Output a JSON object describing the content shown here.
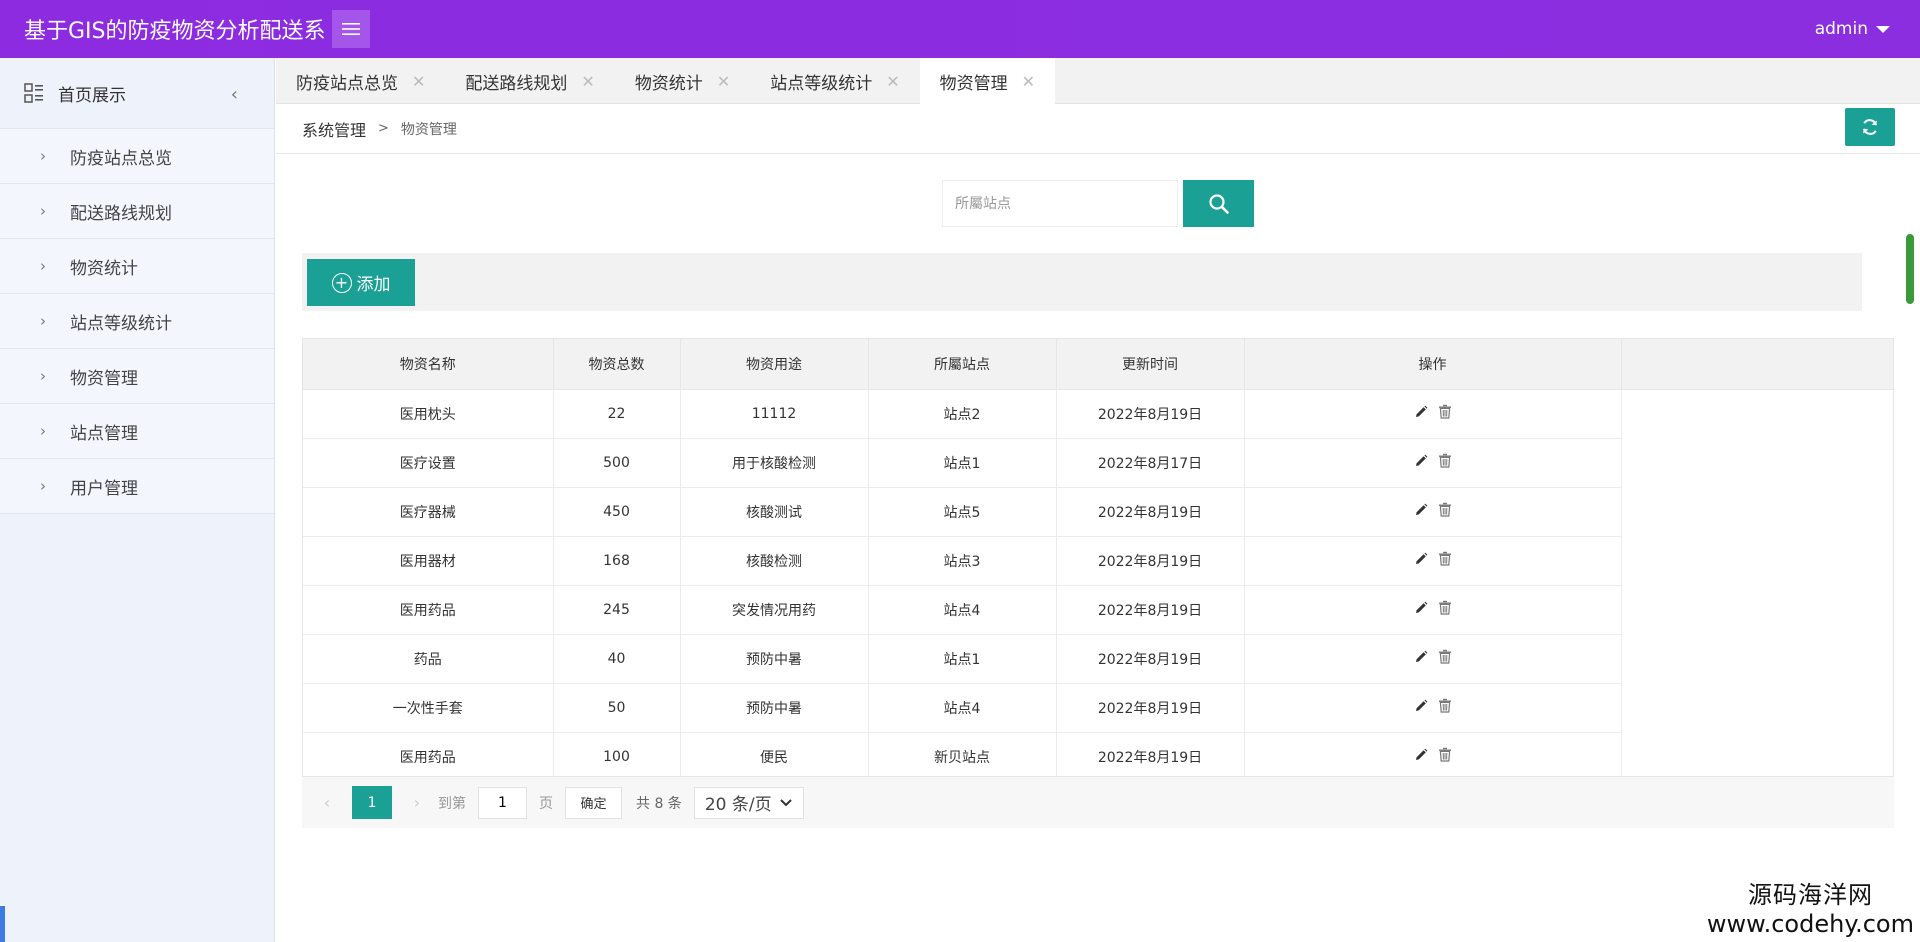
{
  "header": {
    "title": "基于GIS的防疫物资分析配送系",
    "user": "admin"
  },
  "sidebar": {
    "home_label": "首页展示",
    "items": [
      {
        "label": "防疫站点总览"
      },
      {
        "label": "配送路线规划"
      },
      {
        "label": "物资统计"
      },
      {
        "label": "站点等级统计"
      },
      {
        "label": "物资管理"
      },
      {
        "label": "站点管理"
      },
      {
        "label": "用户管理"
      }
    ]
  },
  "tabs": [
    {
      "label": "防疫站点总览",
      "active": false
    },
    {
      "label": "配送路线规划",
      "active": false
    },
    {
      "label": "物资统计",
      "active": false
    },
    {
      "label": "站点等级统计",
      "active": false
    },
    {
      "label": "物资管理",
      "active": true
    }
  ],
  "breadcrumb": {
    "root": "系统管理",
    "separator": ">",
    "current": "物资管理"
  },
  "search": {
    "placeholder": "所屬站点",
    "value": ""
  },
  "toolbar": {
    "add_label": "添加"
  },
  "table": {
    "columns": [
      "物资名称",
      "物资总数",
      "物资用途",
      "所屬站点",
      "更新时间",
      "操作"
    ],
    "rows": [
      [
        "医用枕头",
        "22",
        "11112",
        "站点2",
        "2022年8月19日"
      ],
      [
        "医疗设置",
        "500",
        "用于核酸检测",
        "站点1",
        "2022年8月17日"
      ],
      [
        "医疗器械",
        "450",
        "核酸测试",
        "站点5",
        "2022年8月19日"
      ],
      [
        "医用器材",
        "168",
        "核酸检测",
        "站点3",
        "2022年8月19日"
      ],
      [
        "医用药品",
        "245",
        "突发情况用药",
        "站点4",
        "2022年8月19日"
      ],
      [
        "药品",
        "40",
        "预防中暑",
        "站点1",
        "2022年8月19日"
      ],
      [
        "一次性手套",
        "50",
        "预防中暑",
        "站点4",
        "2022年8月19日"
      ],
      [
        "医用药品",
        "100",
        "便民",
        "新贝站点",
        "2022年8月19日"
      ]
    ]
  },
  "pager": {
    "current_page": "1",
    "goto_label": "到第",
    "goto_value": "1",
    "page_label": "页",
    "confirm_label": "确定",
    "total_label": "共 8 条",
    "page_size_label": "20 条/页"
  },
  "watermark": {
    "line1": "源码海洋网",
    "line2": "www.codehy.com"
  },
  "colors": {
    "header": "#8a2be2",
    "accent": "#1aa094",
    "sidebar_bg": "#eef2fa"
  }
}
